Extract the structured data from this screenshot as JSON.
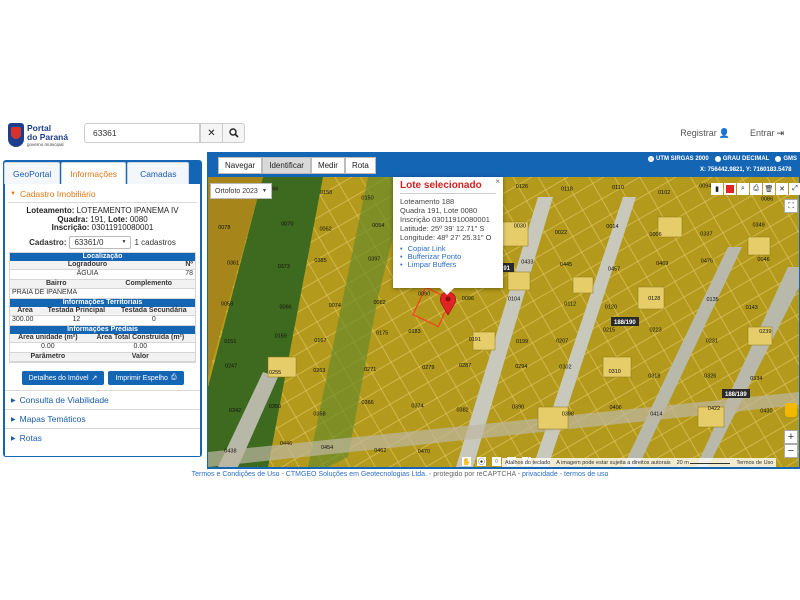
{
  "header": {
    "logo": {
      "line1": "Portal",
      "line2": "do Paraná",
      "line3": "governo municipal"
    },
    "search": {
      "value": "63361"
    },
    "links": {
      "register": "Registrar",
      "login": "Entrar"
    }
  },
  "left": {
    "tabs": [
      {
        "label": "GeoPortal",
        "active": false
      },
      {
        "label": "Informações",
        "active": true
      },
      {
        "label": "Camadas",
        "active": false
      }
    ],
    "cadastro": {
      "title": "Cadastro Imobiliário",
      "loteamento_label": "Loteamento:",
      "loteamento_value": "LOTEAMENTO IPANEMA IV",
      "quadra_label": "Quadra:",
      "quadra_value": "191",
      "lote_label": "Lote:",
      "lote_value": "0080",
      "inscricao_label": "Inscrição:",
      "inscricao_value": "03011910080001",
      "select_label": "Cadastro:",
      "select_value": "63361/0",
      "cadastros_count": "1 cadastros"
    },
    "localizacao": {
      "title": "Localização",
      "col1": "Logradouro",
      "col2": "Nº",
      "logradouro": "ÁGUIA",
      "numero": "78",
      "col3": "Bairro",
      "col4": "Complemento",
      "bairro": "PRAIA DE IPANEMA",
      "complemento": ""
    },
    "territoriais": {
      "title": "Informações Territoriais",
      "cols": [
        "Área",
        "Testada Principal",
        "Testada Secundária"
      ],
      "values": [
        "300.00",
        "12",
        "0"
      ]
    },
    "prediais": {
      "title": "Informações Prediais",
      "cols": [
        "Área unidade (m²)",
        "Área Total Construída (m²)"
      ],
      "values": [
        "0.00",
        "0.00"
      ],
      "cols2": [
        "Parâmetro",
        "Valor"
      ]
    },
    "buttons": {
      "detalhes": "Detalhes do Imóvel",
      "imprimir": "Imprimir Espelho"
    },
    "accordions": [
      "Consulta de Viabilidade",
      "Mapas Temáticos",
      "Rotas"
    ]
  },
  "map": {
    "toolbar": [
      "Navegar",
      "Identificar",
      "Medir",
      "Rota"
    ],
    "active_tool": "Identificar",
    "coord_systems": [
      "UTM SIRGAS 2000",
      "GRAU DECIMAL",
      "GMS"
    ],
    "coord_readout": "X: 756442.9821, Y: 7160183.5478",
    "ortho": "Ortofoto 2023",
    "popup": {
      "title": "Lote selecionado",
      "lines": [
        "Loteamento 188",
        "Quadra 191, Lote 0080",
        "Inscrição 03011910080001",
        "Latitude: 25º 39' 12.71\" S",
        "Longitude: 48º 27' 25.31\" O"
      ],
      "links": [
        "Copiar Link",
        "Bufferizar Ponto",
        "Limpar Buffers"
      ],
      "close": "×"
    },
    "road_labels": [
      "188/190",
      "188/189",
      "191"
    ],
    "lot_labels": [
      "0174",
      "0166",
      "0158",
      "0150",
      "0142",
      "0134",
      "0126",
      "0118",
      "0110",
      "0102",
      "0094",
      "0086",
      "0078",
      "0070",
      "0062",
      "0054",
      "0046",
      "0038",
      "0030",
      "0022",
      "0014",
      "0006",
      "0337",
      "0349",
      "0361",
      "0373",
      "0385",
      "0397",
      "0409",
      "0421",
      "0433",
      "0445",
      "0457",
      "0469",
      "0476",
      "0046",
      "0058",
      "0066",
      "0074",
      "0082",
      "0090",
      "0096",
      "0104",
      "0112",
      "0120",
      "0128",
      "0135",
      "0143",
      "0151",
      "0159",
      "0167",
      "0175",
      "0183",
      "0191",
      "0199",
      "0207",
      "0215",
      "0223",
      "0231",
      "0239",
      "0247",
      "0255",
      "0263",
      "0271",
      "0279",
      "0287",
      "0294",
      "0302",
      "0310",
      "0318",
      "0326",
      "0334",
      "0342",
      "0350",
      "0358",
      "0366",
      "0374",
      "0382",
      "0390",
      "0398",
      "0406",
      "0414",
      "0422",
      "0430",
      "0438",
      "0446",
      "0454",
      "0462",
      "0470"
    ],
    "bottom_bar": {
      "shortcuts": "Atalhos do teclado",
      "image_note": "A imagem pode estar sujeita a direitos autorais",
      "scale": "20 m",
      "terms": "Termos de Uso"
    }
  },
  "footer": {
    "terms": "Termos e Condições de Uso",
    "company": "CTMGEO Soluções em Geotecnologias Ltda.",
    "protected": "- protegido por reCAPTCHA -",
    "privacy": "privacidade",
    "terms_of_use": "termos de uso"
  }
}
